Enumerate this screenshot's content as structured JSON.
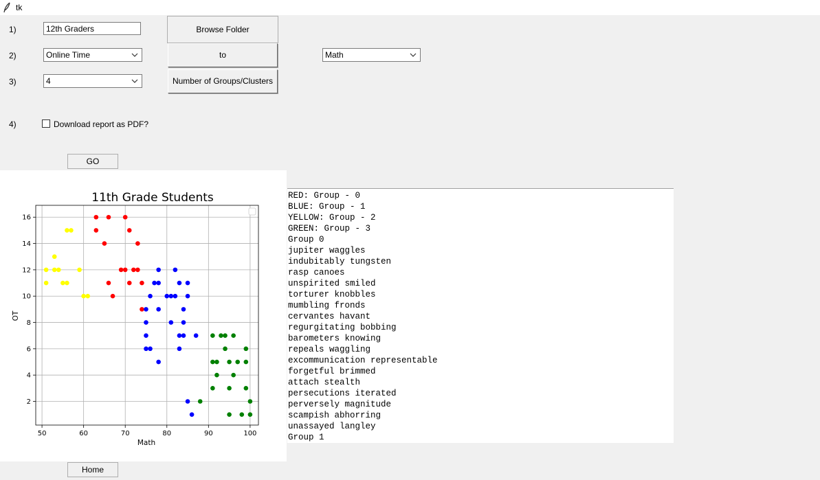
{
  "window": {
    "title": "tk"
  },
  "rows": {
    "row1": {
      "num": "1)",
      "entry_value": "12th Graders",
      "button": "Browse Folder"
    },
    "row2": {
      "num": "2)",
      "combo_left": "Online Time",
      "button": "to",
      "combo_right": "Math"
    },
    "row3": {
      "num": "3)",
      "combo_value": "4",
      "button": "Number of Groups/Clusters"
    },
    "row4": {
      "num": "4)",
      "checkbox_label": "Download report as PDF?",
      "checked": false
    }
  },
  "go_button": "GO",
  "home_button": "Home",
  "report_lines": [
    "RED: Group - 0",
    "BLUE: Group - 1",
    "YELLOW: Group - 2",
    "GREEN: Group - 3",
    "Group 0",
    "jupiter waggles",
    "indubitably tungsten",
    "rasp canoes",
    "unspirited smiled",
    "torturer knobbles",
    "mumbling fronds",
    "cervantes havant",
    "regurgitating bobbing",
    "barometers knowing",
    "repeals waggling",
    "excommunication representable",
    "forgetful brimmed",
    "attach stealth",
    "persecutions iterated",
    "perversely magnitude",
    "scampish abhorring",
    "unassayed langley",
    "Group 1"
  ],
  "chart_data": {
    "type": "scatter",
    "title": "11th Grade Students",
    "xlabel": "Math",
    "ylabel": "OT",
    "xlim": [
      48.5,
      102
    ],
    "ylim": [
      0.2,
      16.9
    ],
    "xticks": [
      50,
      60,
      70,
      80,
      90,
      100
    ],
    "yticks": [
      2,
      4,
      6,
      8,
      10,
      12,
      14,
      16
    ],
    "grid": true,
    "legend": "top-right",
    "colors": {
      "red": "#ff0000",
      "blue": "#0000ff",
      "yellow": "#ffff00",
      "green": "#008000"
    },
    "series": [
      {
        "color": "red",
        "points": [
          [
            63,
            16
          ],
          [
            66,
            16
          ],
          [
            70,
            16
          ],
          [
            63,
            15
          ],
          [
            71,
            15
          ],
          [
            65,
            14
          ],
          [
            73,
            14
          ],
          [
            69,
            12
          ],
          [
            70,
            12
          ],
          [
            72,
            12
          ],
          [
            73,
            12
          ],
          [
            66,
            11
          ],
          [
            71,
            11
          ],
          [
            74,
            11
          ],
          [
            67,
            10
          ],
          [
            74,
            9
          ]
        ]
      },
      {
        "color": "blue",
        "points": [
          [
            78,
            12
          ],
          [
            82,
            12
          ],
          [
            77,
            11
          ],
          [
            78,
            11
          ],
          [
            83,
            11
          ],
          [
            85,
            11
          ],
          [
            76,
            10
          ],
          [
            80,
            10
          ],
          [
            81,
            10
          ],
          [
            82,
            10
          ],
          [
            85,
            10
          ],
          [
            75,
            9
          ],
          [
            78,
            9
          ],
          [
            84,
            9
          ],
          [
            75,
            8
          ],
          [
            81,
            8
          ],
          [
            84,
            8
          ],
          [
            75,
            7
          ],
          [
            83,
            7
          ],
          [
            84,
            7
          ],
          [
            87,
            7
          ],
          [
            75,
            6
          ],
          [
            76,
            6
          ],
          [
            83,
            6
          ],
          [
            78,
            5
          ],
          [
            85,
            2
          ],
          [
            86,
            1
          ]
        ]
      },
      {
        "color": "yellow",
        "points": [
          [
            56,
            15
          ],
          [
            57,
            15
          ],
          [
            53,
            13
          ],
          [
            51,
            12
          ],
          [
            53,
            12
          ],
          [
            54,
            12
          ],
          [
            59,
            12
          ],
          [
            51,
            11
          ],
          [
            55,
            11
          ],
          [
            56,
            11
          ],
          [
            60,
            10
          ],
          [
            61,
            10
          ]
        ]
      },
      {
        "color": "green",
        "points": [
          [
            91,
            7
          ],
          [
            93,
            7
          ],
          [
            94,
            7
          ],
          [
            96,
            7
          ],
          [
            94,
            6
          ],
          [
            99,
            6
          ],
          [
            91,
            5
          ],
          [
            92,
            5
          ],
          [
            95,
            5
          ],
          [
            97,
            5
          ],
          [
            99,
            5
          ],
          [
            92,
            4
          ],
          [
            96,
            4
          ],
          [
            91,
            3
          ],
          [
            95,
            3
          ],
          [
            99,
            3
          ],
          [
            88,
            2
          ],
          [
            100,
            2
          ],
          [
            95,
            1
          ],
          [
            98,
            1
          ],
          [
            100,
            1
          ]
        ]
      }
    ]
  }
}
